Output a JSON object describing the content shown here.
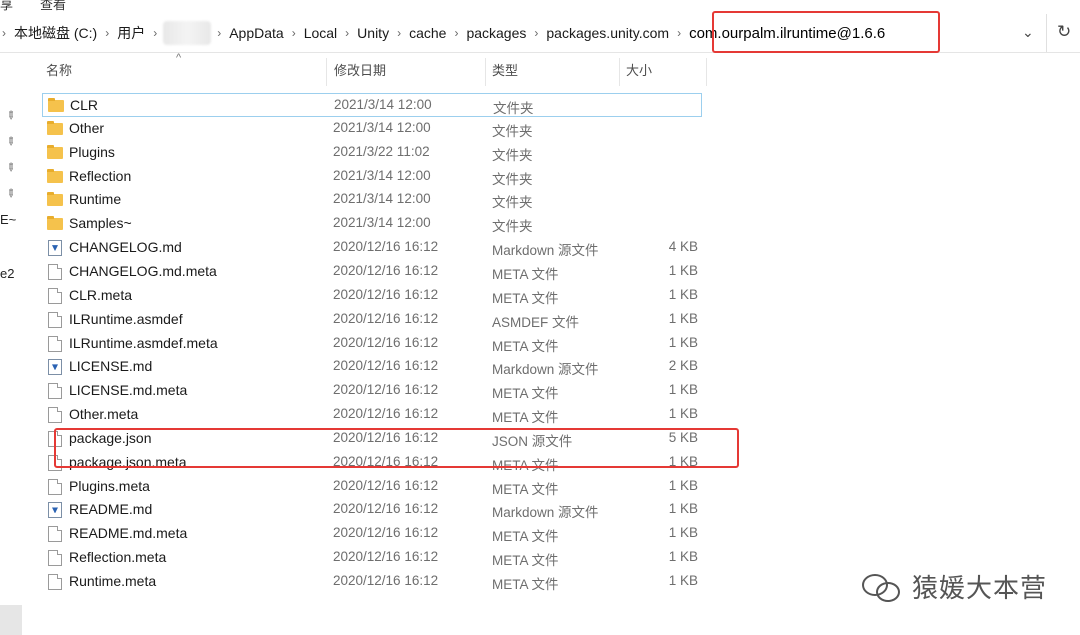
{
  "ribbon": [
    "享",
    "查看"
  ],
  "breadcrumb": {
    "items": [
      "本地磁盘 (C:)",
      "用户",
      "AppData",
      "Local",
      "Unity",
      "cache",
      "packages",
      "packages.unity.com"
    ],
    "current": "com.ourpalm.ilruntime@1.6.6",
    "separator": "›"
  },
  "icons": {
    "dropdown": "⌄",
    "refresh": "↻",
    "pin": "📌",
    "sort": "^"
  },
  "nav_fragments": [
    "E~",
    "e2"
  ],
  "columns": {
    "name": "名称",
    "date": "修改日期",
    "type": "类型",
    "size": "大小"
  },
  "files": [
    {
      "name": "CLR",
      "date": "2021/3/14 12:00",
      "type": "文件夹",
      "size": "",
      "icon": "folder"
    },
    {
      "name": "Other",
      "date": "2021/3/14 12:00",
      "type": "文件夹",
      "size": "",
      "icon": "folder"
    },
    {
      "name": "Plugins",
      "date": "2021/3/22 11:02",
      "type": "文件夹",
      "size": "",
      "icon": "folder"
    },
    {
      "name": "Reflection",
      "date": "2021/3/14 12:00",
      "type": "文件夹",
      "size": "",
      "icon": "folder"
    },
    {
      "name": "Runtime",
      "date": "2021/3/14 12:00",
      "type": "文件夹",
      "size": "",
      "icon": "folder"
    },
    {
      "name": "Samples~",
      "date": "2021/3/14 12:00",
      "type": "文件夹",
      "size": "",
      "icon": "folder"
    },
    {
      "name": "CHANGELOG.md",
      "date": "2020/12/16 16:12",
      "type": "Markdown 源文件",
      "size": "4 KB",
      "icon": "markdown"
    },
    {
      "name": "CHANGELOG.md.meta",
      "date": "2020/12/16 16:12",
      "type": "META 文件",
      "size": "1 KB",
      "icon": "file"
    },
    {
      "name": "CLR.meta",
      "date": "2020/12/16 16:12",
      "type": "META 文件",
      "size": "1 KB",
      "icon": "file"
    },
    {
      "name": "ILRuntime.asmdef",
      "date": "2020/12/16 16:12",
      "type": "ASMDEF 文件",
      "size": "1 KB",
      "icon": "file"
    },
    {
      "name": "ILRuntime.asmdef.meta",
      "date": "2020/12/16 16:12",
      "type": "META 文件",
      "size": "1 KB",
      "icon": "file"
    },
    {
      "name": "LICENSE.md",
      "date": "2020/12/16 16:12",
      "type": "Markdown 源文件",
      "size": "2 KB",
      "icon": "markdown"
    },
    {
      "name": "LICENSE.md.meta",
      "date": "2020/12/16 16:12",
      "type": "META 文件",
      "size": "1 KB",
      "icon": "file"
    },
    {
      "name": "Other.meta",
      "date": "2020/12/16 16:12",
      "type": "META 文件",
      "size": "1 KB",
      "icon": "file"
    },
    {
      "name": "package.json",
      "date": "2020/12/16 16:12",
      "type": "JSON 源文件",
      "size": "5 KB",
      "icon": "file"
    },
    {
      "name": "package.json.meta",
      "date": "2020/12/16 16:12",
      "type": "META 文件",
      "size": "1 KB",
      "icon": "file"
    },
    {
      "name": "Plugins.meta",
      "date": "2020/12/16 16:12",
      "type": "META 文件",
      "size": "1 KB",
      "icon": "file"
    },
    {
      "name": "README.md",
      "date": "2020/12/16 16:12",
      "type": "Markdown 源文件",
      "size": "1 KB",
      "icon": "markdown"
    },
    {
      "name": "README.md.meta",
      "date": "2020/12/16 16:12",
      "type": "META 文件",
      "size": "1 KB",
      "icon": "file"
    },
    {
      "name": "Reflection.meta",
      "date": "2020/12/16 16:12",
      "type": "META 文件",
      "size": "1 KB",
      "icon": "file"
    },
    {
      "name": "Runtime.meta",
      "date": "2020/12/16 16:12",
      "type": "META 文件",
      "size": "1 KB",
      "icon": "file"
    }
  ],
  "watermark": "猿媛大本营",
  "colors": {
    "highlight_box": "#e53935",
    "folder": "#f5c24c",
    "selection_border": "#9ccfee"
  }
}
